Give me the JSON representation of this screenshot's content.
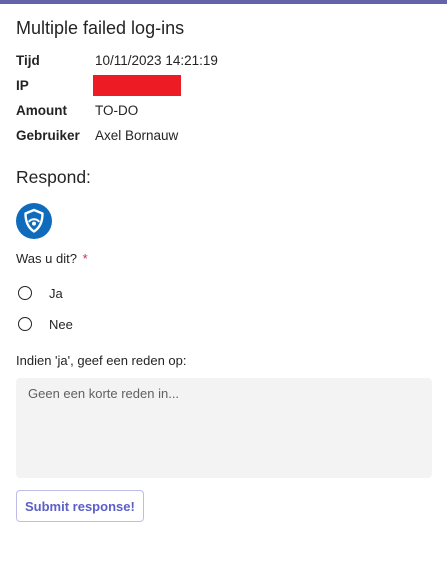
{
  "card": {
    "title": "Multiple failed log-ins",
    "facts": [
      {
        "key": "Tijd",
        "value": "10/11/2023 14:21:19"
      },
      {
        "key": "IP",
        "value": ""
      },
      {
        "key": "Amount",
        "value": "TO-DO"
      },
      {
        "key": "Gebruiker",
        "value": "Axel Bornauw"
      }
    ],
    "redaction_color": "#ed1c24"
  },
  "respond": {
    "heading": "Respond:",
    "icon": "shield-icon",
    "icon_color": "#0f6cbd",
    "question": "Was u dit?",
    "required_marker": "*",
    "options": [
      {
        "label": "Ja",
        "selected": false
      },
      {
        "label": "Nee",
        "selected": false
      }
    ],
    "reason_label": "Indien 'ja', geef een reden op:",
    "reason_placeholder": "Geen een korte reden in...",
    "reason_value": "",
    "submit_label": "Submit response!"
  },
  "theme": {
    "accent": "#6264a7",
    "button_text": "#5b5fc7"
  }
}
